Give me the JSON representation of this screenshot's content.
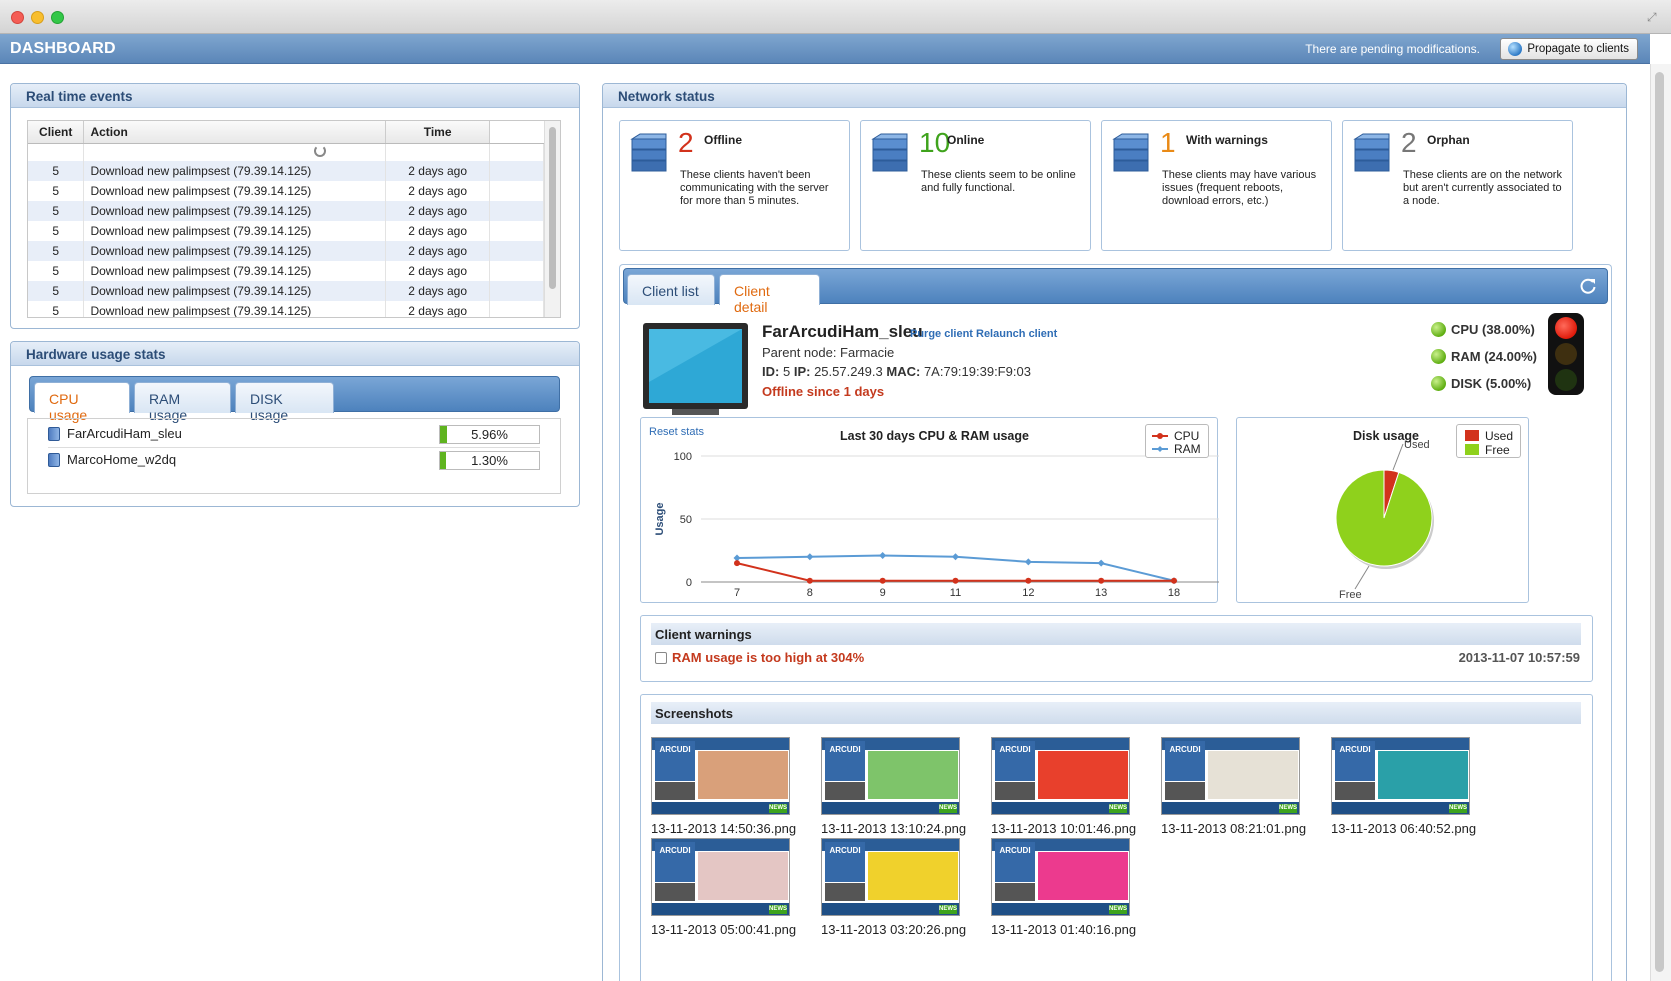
{
  "header": {
    "title": "DASHBOARD",
    "pending": "There are pending modifications.",
    "propagate_label": "Propagate to clients"
  },
  "realtime": {
    "title": "Real time events",
    "columns": [
      "Client",
      "Action",
      "Time"
    ],
    "rows": [
      {
        "client": "5",
        "action": "Download new palimpsest (79.39.14.125)",
        "time": "2 days ago"
      },
      {
        "client": "5",
        "action": "Download new palimpsest (79.39.14.125)",
        "time": "2 days ago"
      },
      {
        "client": "5",
        "action": "Download new palimpsest (79.39.14.125)",
        "time": "2 days ago"
      },
      {
        "client": "5",
        "action": "Download new palimpsest (79.39.14.125)",
        "time": "2 days ago"
      },
      {
        "client": "5",
        "action": "Download new palimpsest (79.39.14.125)",
        "time": "2 days ago"
      },
      {
        "client": "5",
        "action": "Download new palimpsest (79.39.14.125)",
        "time": "2 days ago"
      },
      {
        "client": "5",
        "action": "Download new palimpsest (79.39.14.125)",
        "time": "2 days ago"
      },
      {
        "client": "5",
        "action": "Download new palimpsest (79.39.14.125)",
        "time": "2 days ago"
      }
    ]
  },
  "hardware": {
    "title": "Hardware usage stats",
    "tabs": [
      "CPU usage",
      "RAM usage",
      "DISK usage"
    ],
    "active_tab": "CPU usage",
    "rows": [
      {
        "name": "FarArcudiHam_sleu",
        "value": "5.96%",
        "fraction": 0.0596
      },
      {
        "name": "MarcoHome_w2dq",
        "value": "1.30%",
        "fraction": 0.013
      }
    ]
  },
  "network": {
    "title": "Network status",
    "stats": [
      {
        "count": "2",
        "label": "Offline",
        "color": "#d2321c",
        "desc": "These clients haven't been communicating with the server for more than 5 minutes."
      },
      {
        "count": "10",
        "label": "Online",
        "color": "#3fa31c",
        "desc": "These clients seem to be online and fully functional."
      },
      {
        "count": "1",
        "label": "With warnings",
        "color": "#e98a16",
        "desc": "These clients may have various issues (frequent reboots, download errors, etc.)"
      },
      {
        "count": "2",
        "label": "Orphan",
        "color": "#777777",
        "desc": "These clients are on the network but aren't currently associated to a node."
      }
    ],
    "tabs": [
      "Client list",
      "Client detail"
    ],
    "active_tab": "Client detail"
  },
  "client": {
    "name": "FarArcudiHam_sleu",
    "purge_label": "Purge client",
    "relaunch_label": "Relaunch client",
    "parent_node": "Parent node: Farmacie",
    "id_label": "ID:",
    "id": "5",
    "ip_label": "IP:",
    "ip": "25.57.249.3",
    "mac_label": "MAC:",
    "mac": "7A:79:19:39:F9:03",
    "offline_since": "Offline since 1 days",
    "metrics": [
      "CPU (38.00%)",
      "RAM (24.00%)",
      "DISK (5.00%)"
    ],
    "traffic_light": "red"
  },
  "chart_data": [
    {
      "type": "line",
      "title": "Last 30 days CPU & RAM usage",
      "reset_label": "Reset stats",
      "ylabel": "Usage",
      "xlabel": "",
      "ylim": [
        0,
        100
      ],
      "yticks": [
        0,
        50,
        100
      ],
      "categories": [
        "7",
        "8",
        "9",
        "11",
        "12",
        "13",
        "18"
      ],
      "series": [
        {
          "name": "CPU",
          "color": "#d2321c",
          "values": [
            15,
            1,
            1,
            1,
            1,
            1,
            1
          ]
        },
        {
          "name": "RAM",
          "color": "#5b9bd5",
          "values": [
            19,
            20,
            21,
            20,
            16,
            15,
            1
          ]
        }
      ],
      "legend_position": "top-right",
      "grid": true
    },
    {
      "type": "pie",
      "title": "Disk usage",
      "series": [
        {
          "name": "Used",
          "color": "#d2321c",
          "value": 5
        },
        {
          "name": "Free",
          "color": "#8fd11c",
          "value": 95
        }
      ],
      "legend_position": "top-right"
    }
  ],
  "warnings": {
    "title": "Client warnings",
    "items": [
      {
        "text": "RAM usage is too high at 304%",
        "time": "2013-11-07 10:57:59"
      }
    ]
  },
  "screenshots": {
    "title": "Screenshots",
    "items": [
      {
        "caption": "13-11-2013 14:50:36.png",
        "accent": "#d9a07a"
      },
      {
        "caption": "13-11-2013 13:10:24.png",
        "accent": "#7ec46a"
      },
      {
        "caption": "13-11-2013 10:01:46.png",
        "accent": "#e8402c"
      },
      {
        "caption": "13-11-2013 08:21:01.png",
        "accent": "#e6e1d6"
      },
      {
        "caption": "13-11-2013 06:40:52.png",
        "accent": "#2aa0a8"
      },
      {
        "caption": "13-11-2013 05:00:41.png",
        "accent": "#e4c6c4"
      },
      {
        "caption": "13-11-2013 03:20:26.png",
        "accent": "#f0d12c"
      },
      {
        "caption": "13-11-2013 01:40:16.png",
        "accent": "#ec3a8e"
      }
    ],
    "logo_text": "ARCUDI",
    "news_badge": "NEWS"
  }
}
